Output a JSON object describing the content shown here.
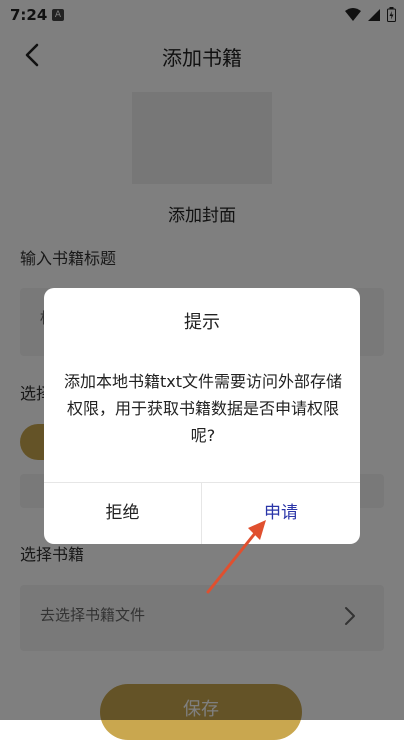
{
  "status_bar": {
    "time": "7:24",
    "a_badge": "A"
  },
  "header": {
    "title": "添加书籍"
  },
  "cover": {
    "label": "添加封面"
  },
  "form": {
    "title_label": "输入书籍标题",
    "title_input_partial": "标",
    "type_label_partial": "选择",
    "book_label": "选择书籍",
    "book_placeholder": "去选择书籍文件"
  },
  "save_button": "保存",
  "dialog": {
    "title": "提示",
    "message": "添加本地书籍txt文件需要访问外部存储权限，用于获取书籍数据是否申请权限呢?",
    "deny": "拒绝",
    "apply": "申请"
  },
  "colors": {
    "accent": "#c9a74f",
    "apply_text": "#2a35a8",
    "arrow": "#e0502f"
  },
  "icons": [
    "back-arrow-icon",
    "wifi-icon",
    "signal-icon",
    "battery-icon",
    "chevron-right-icon"
  ]
}
